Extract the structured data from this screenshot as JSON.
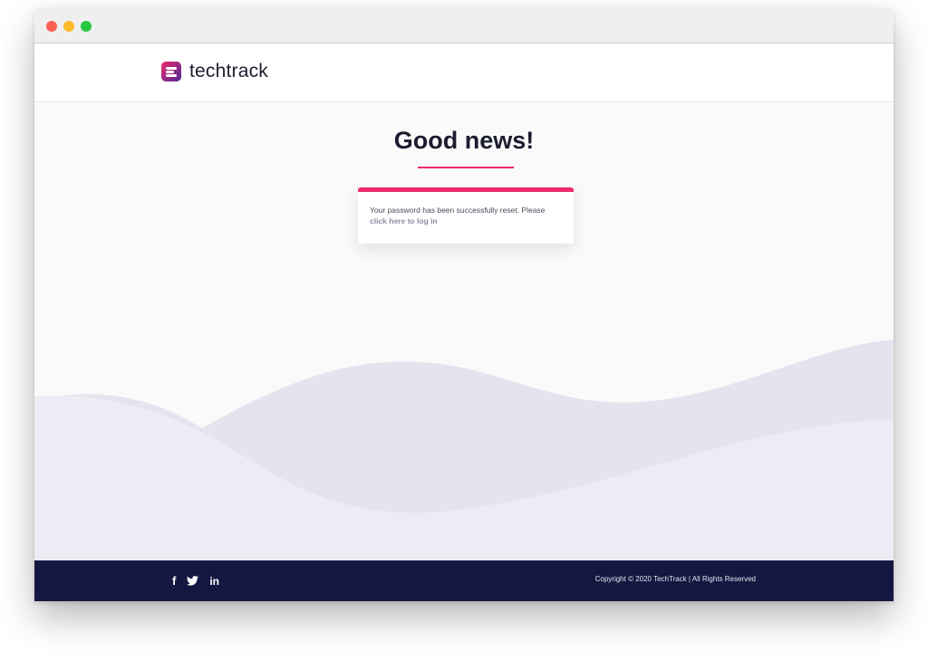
{
  "brand": {
    "name": "techtrack",
    "colors": {
      "accent": "#ee2a6b",
      "logo_gradient_start": "#ee2a6b",
      "logo_gradient_end": "#4b2b9a",
      "footer_bg": "#141840",
      "wave_light": "#ececf4",
      "wave_dark": "#e4e4ef",
      "link": "#8c8ea4"
    }
  },
  "window_controls": {
    "close_color": "#fd5f57",
    "minimize_color": "#fdbb2e",
    "maximize_color": "#27c840"
  },
  "main": {
    "headline": "Good news!",
    "message": {
      "text": "Your password has been successfully reset. Please ",
      "link_text": "click here to log in"
    }
  },
  "footer": {
    "social_icons": [
      "facebook-icon",
      "twitter-icon",
      "linkedin-icon"
    ],
    "linkedin_label": "in",
    "facebook_label": "f",
    "copyright": "Copyright © 2020 TechTrack | All Rights Reserved"
  }
}
